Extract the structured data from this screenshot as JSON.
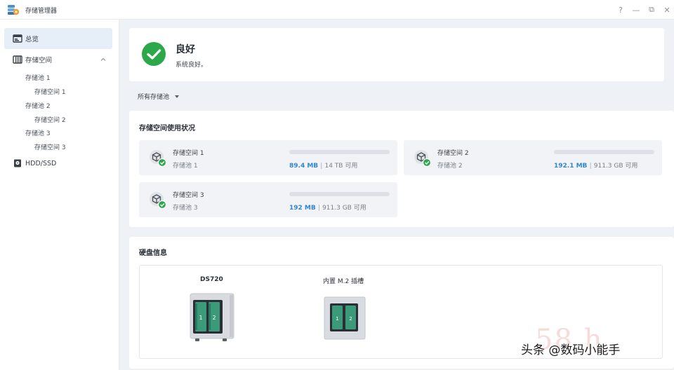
{
  "app": {
    "title": "存储管理器"
  },
  "window_controls": {
    "help": "?",
    "minimize": "—",
    "restore": "⧉",
    "close": "✕"
  },
  "sidebar": {
    "overview": "总览",
    "storage": "存储空间",
    "pools": [
      {
        "pool": "存储池 1",
        "volume": "存储空间 1"
      },
      {
        "pool": "存储池 2",
        "volume": "存储空间 2"
      },
      {
        "pool": "存储池 3",
        "volume": "存储空间 3"
      }
    ],
    "hdd": "HDD/SSD"
  },
  "status": {
    "title": "良好",
    "subtitle": "系统良好。",
    "color": "#2aa84a"
  },
  "filter": {
    "label": "所有存储池"
  },
  "usage": {
    "title": "存储空间使用状况",
    "volumes": [
      {
        "name": "存储空间 1",
        "pool": "存储池 1",
        "used": "89.4 MB",
        "sep": "|",
        "avail": "14 TB 可用"
      },
      {
        "name": "存储空间 2",
        "pool": "存储池 2",
        "used": "192.1 MB",
        "sep": "|",
        "avail": "911.3 GB 可用"
      },
      {
        "name": "存储空间 3",
        "pool": "存储池 3",
        "used": "192 MB",
        "sep": "|",
        "avail": "911.3 GB 可用"
      }
    ]
  },
  "disks": {
    "title": "硬盘信息",
    "ds720": {
      "label": "DS720",
      "slots": [
        "1",
        "2"
      ]
    },
    "m2": {
      "label": "内置 M.2 插槽",
      "slots": [
        "1",
        "2"
      ]
    }
  },
  "watermark": {
    "text": "头条 @数码小能手",
    "faded": "58 h"
  },
  "colors": {
    "accent": "#2f86d6",
    "ok": "#2aa84a",
    "active_nav": "#e6eef8"
  }
}
